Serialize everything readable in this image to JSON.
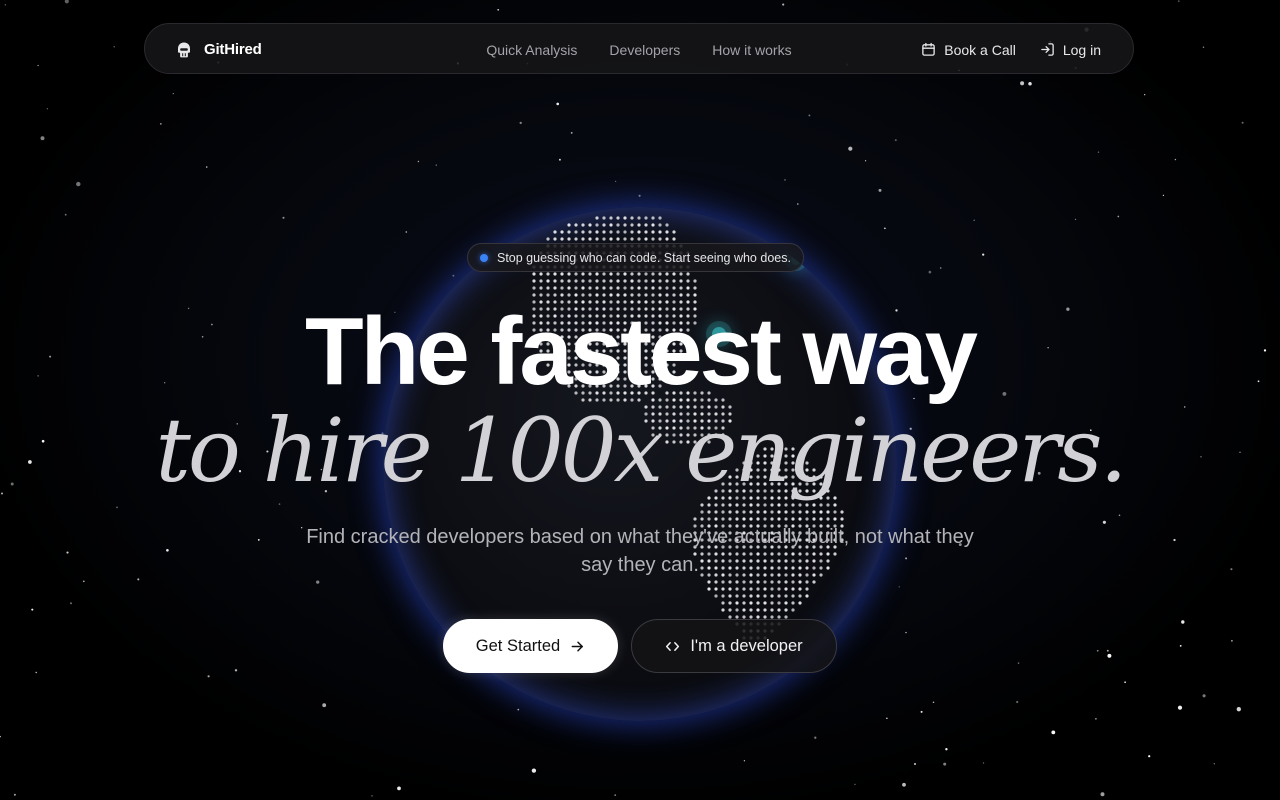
{
  "brand": {
    "name": "GitHired",
    "logo_icon": "helmet-logo-icon"
  },
  "nav": {
    "links": [
      {
        "label": "Quick Analysis"
      },
      {
        "label": "Developers"
      },
      {
        "label": "How it works"
      }
    ],
    "book_call": {
      "label": "Book a Call",
      "icon": "calendar-icon"
    },
    "login": {
      "label": "Log in",
      "icon": "login-icon"
    }
  },
  "hero": {
    "badge": "Stop guessing who can code. Start seeing who does.",
    "headline_line1": "The fastest way",
    "headline_line2": "to hire 100x engineers.",
    "subtext": "Find cracked developers based on what they've actually built, not what they say they can.",
    "cta_primary": {
      "label": "Get Started",
      "icon": "arrow-right-icon"
    },
    "cta_secondary": {
      "label": "I'm a developer",
      "icon": "code-icon"
    }
  },
  "colors": {
    "background": "#000000",
    "accent": "#3b82f6",
    "globe_glow": "#2846c8",
    "ping": "#40e0e6"
  }
}
